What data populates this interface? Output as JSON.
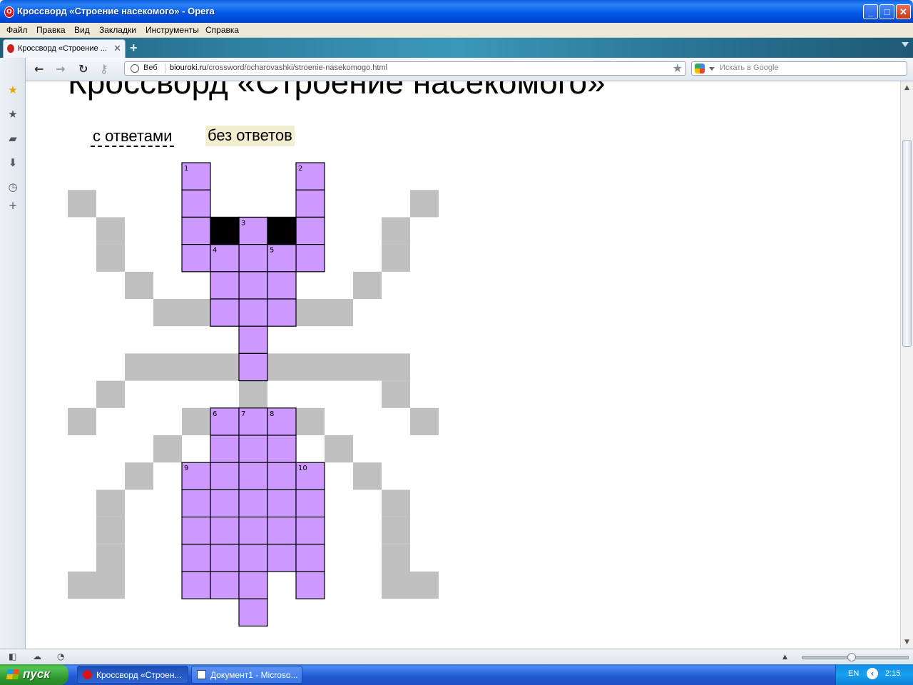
{
  "window": {
    "title": "Кроссворд «Строение насекомого» - Opera",
    "minimize_glyph": "_",
    "maximize_glyph": "□",
    "close_glyph": "✕"
  },
  "menu": [
    "Файл",
    "Правка",
    "Вид",
    "Закладки",
    "Инструменты",
    "Справка"
  ],
  "tabs": [
    {
      "label": "Кроссворд «Строение ...",
      "close_glyph": "✕"
    }
  ],
  "new_tab_glyph": "+",
  "address": {
    "badge": "Веб",
    "host": "biouroki.ru",
    "path": "/crossword/ocharovashki/stroenie-nasekomogo.html"
  },
  "search": {
    "placeholder": "Искать в Google"
  },
  "sidebar_icons": [
    "bookmark-star-icon",
    "favorites-star-icon",
    "notes-icon",
    "downloads-icon",
    "history-clock-icon",
    "add-panel-icon"
  ],
  "page": {
    "title": "Кроссворд «Строение насекомого»",
    "link_with_answers": "с ответами",
    "link_without_answers": "без ответов"
  },
  "colors": {
    "cell_fill": "#cc99ff",
    "cell_border": "#000000",
    "leg_gray": "#c0c0c0",
    "eye_black": "#000000",
    "no_answers_highlight": "#f2efd0"
  },
  "crossword": {
    "cells": [
      [
        4,
        0
      ],
      [
        4,
        1
      ],
      [
        4,
        2
      ],
      [
        4,
        3
      ],
      [
        8,
        0
      ],
      [
        8,
        1
      ],
      [
        8,
        2
      ],
      [
        8,
        3
      ],
      [
        6,
        2
      ],
      [
        6,
        3
      ],
      [
        6,
        4
      ],
      [
        6,
        5
      ],
      [
        6,
        6
      ],
      [
        6,
        7
      ],
      [
        5,
        3
      ],
      [
        5,
        4
      ],
      [
        5,
        5
      ],
      [
        7,
        3
      ],
      [
        7,
        4
      ],
      [
        7,
        5
      ],
      [
        5,
        9
      ],
      [
        5,
        10
      ],
      [
        5,
        11
      ],
      [
        5,
        12
      ],
      [
        5,
        13
      ],
      [
        5,
        14
      ],
      [
        5,
        15
      ],
      [
        6,
        9
      ],
      [
        6,
        10
      ],
      [
        6,
        11
      ],
      [
        6,
        12
      ],
      [
        6,
        13
      ],
      [
        6,
        14
      ],
      [
        6,
        15
      ],
      [
        6,
        16
      ],
      [
        7,
        9
      ],
      [
        7,
        10
      ],
      [
        7,
        11
      ],
      [
        7,
        12
      ],
      [
        7,
        13
      ],
      [
        7,
        14
      ],
      [
        4,
        11
      ],
      [
        4,
        12
      ],
      [
        4,
        13
      ],
      [
        4,
        14
      ],
      [
        4,
        15
      ],
      [
        8,
        11
      ],
      [
        8,
        12
      ],
      [
        8,
        13
      ],
      [
        8,
        14
      ],
      [
        8,
        15
      ]
    ],
    "black_cells": [
      [
        5,
        2
      ],
      [
        7,
        2
      ]
    ],
    "numbers": [
      {
        "n": "1",
        "c": 4,
        "r": 0
      },
      {
        "n": "2",
        "c": 8,
        "r": 0
      },
      {
        "n": "3",
        "c": 6,
        "r": 2
      },
      {
        "n": "4",
        "c": 5,
        "r": 3
      },
      {
        "n": "5",
        "c": 7,
        "r": 3
      },
      {
        "n": "6",
        "c": 5,
        "r": 9
      },
      {
        "n": "7",
        "c": 6,
        "r": 9
      },
      {
        "n": "8",
        "c": 7,
        "r": 9
      },
      {
        "n": "9",
        "c": 4,
        "r": 11
      },
      {
        "n": "10",
        "c": 8,
        "r": 11
      }
    ],
    "gray_cells": [
      [
        0,
        1
      ],
      [
        1,
        2
      ],
      [
        1,
        3
      ],
      [
        2,
        4
      ],
      [
        3,
        5
      ],
      [
        4,
        5
      ],
      [
        12,
        1
      ],
      [
        11,
        2
      ],
      [
        11,
        3
      ],
      [
        10,
        4
      ],
      [
        9,
        5
      ],
      [
        8,
        5
      ],
      [
        2,
        7
      ],
      [
        3,
        7
      ],
      [
        4,
        7
      ],
      [
        5,
        7
      ],
      [
        7,
        7
      ],
      [
        8,
        7
      ],
      [
        9,
        7
      ],
      [
        10,
        7
      ],
      [
        11,
        7
      ],
      [
        1,
        8
      ],
      [
        6,
        8
      ],
      [
        11,
        8
      ],
      [
        0,
        9
      ],
      [
        4,
        9
      ],
      [
        8,
        9
      ],
      [
        12,
        9
      ],
      [
        3,
        10
      ],
      [
        9,
        10
      ],
      [
        2,
        11
      ],
      [
        10,
        11
      ],
      [
        1,
        12
      ],
      [
        1,
        13
      ],
      [
        1,
        14
      ],
      [
        0,
        15
      ],
      [
        1,
        15
      ],
      [
        11,
        12
      ],
      [
        11,
        13
      ],
      [
        11,
        14
      ],
      [
        11,
        15
      ],
      [
        12,
        15
      ]
    ]
  },
  "statusbar_icons": [
    "panel-toggle-icon",
    "opera-unite-icon",
    "opera-turbo-icon"
  ],
  "taskbar": {
    "start_label": "пуск",
    "items": [
      {
        "label": "Кроссворд «Строен...",
        "active": true
      },
      {
        "label": "Документ1 - Microso...",
        "active": false
      }
    ],
    "language": "EN",
    "clock": "2:15"
  }
}
